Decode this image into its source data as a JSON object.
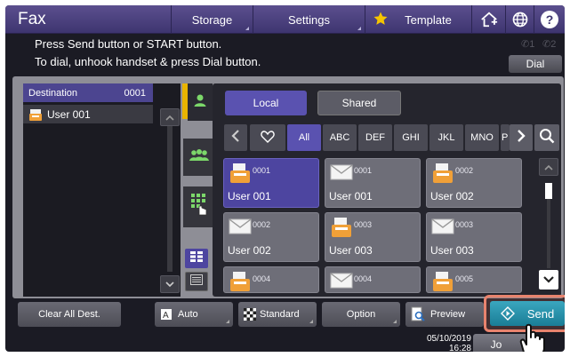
{
  "app": {
    "title": "Fax"
  },
  "topnav": {
    "tabs": [
      {
        "label": "Storage"
      },
      {
        "label": "Settings"
      },
      {
        "label": "Template",
        "icon": "star-icon"
      }
    ],
    "icons": [
      "home-add-icon",
      "globe-icon",
      "help-icon"
    ],
    "help_glyph": "?"
  },
  "message": {
    "line1": "Press Send button or START button.",
    "line2": "To dial, unhook handset & press Dial button."
  },
  "phone_indicators": [
    "1",
    "2"
  ],
  "dial_label": "Dial",
  "destination": {
    "header_label": "Destination",
    "count": "0001",
    "items": [
      {
        "label": "User 001",
        "icon": "fax-icon"
      }
    ]
  },
  "directory": {
    "scope_tabs": [
      {
        "label": "Local",
        "active": true
      },
      {
        "label": "Shared",
        "active": false
      }
    ],
    "filters": [
      {
        "label": "♡",
        "icon": "favorite-icon"
      },
      {
        "label": "All",
        "active": true
      },
      {
        "label": "ABC"
      },
      {
        "label": "DEF"
      },
      {
        "label": "GHI"
      },
      {
        "label": "JKL"
      },
      {
        "label": "MNO"
      },
      {
        "label": "P"
      }
    ],
    "entries": [
      {
        "num": "0001",
        "name": "User 001",
        "type": "fax",
        "selected": true
      },
      {
        "num": "0001",
        "name": "User 001",
        "type": "email",
        "selected": false
      },
      {
        "num": "0002",
        "name": "User 002",
        "type": "fax",
        "selected": false
      },
      {
        "num": "0002",
        "name": "User 002",
        "type": "email",
        "selected": false
      },
      {
        "num": "0003",
        "name": "User 003",
        "type": "fax",
        "selected": false
      },
      {
        "num": "0003",
        "name": "User 003",
        "type": "email",
        "selected": false
      },
      {
        "num": "0004",
        "name": "",
        "type": "fax",
        "selected": false
      },
      {
        "num": "0004",
        "name": "",
        "type": "email",
        "selected": false
      },
      {
        "num": "0005",
        "name": "",
        "type": "fax",
        "selected": false
      }
    ]
  },
  "actions": {
    "clear_all": "Clear All Dest.",
    "auto": "Auto",
    "standard": "Standard",
    "option": "Option",
    "preview": "Preview",
    "send": "Send"
  },
  "status": {
    "date": "05/10/2019",
    "time": "16:28",
    "job_label": "Jo"
  },
  "colors": {
    "accent": "#4d45a0",
    "send": "#2a93ad",
    "highlight": "#e8836e",
    "tab_marker": "#e8b400"
  }
}
